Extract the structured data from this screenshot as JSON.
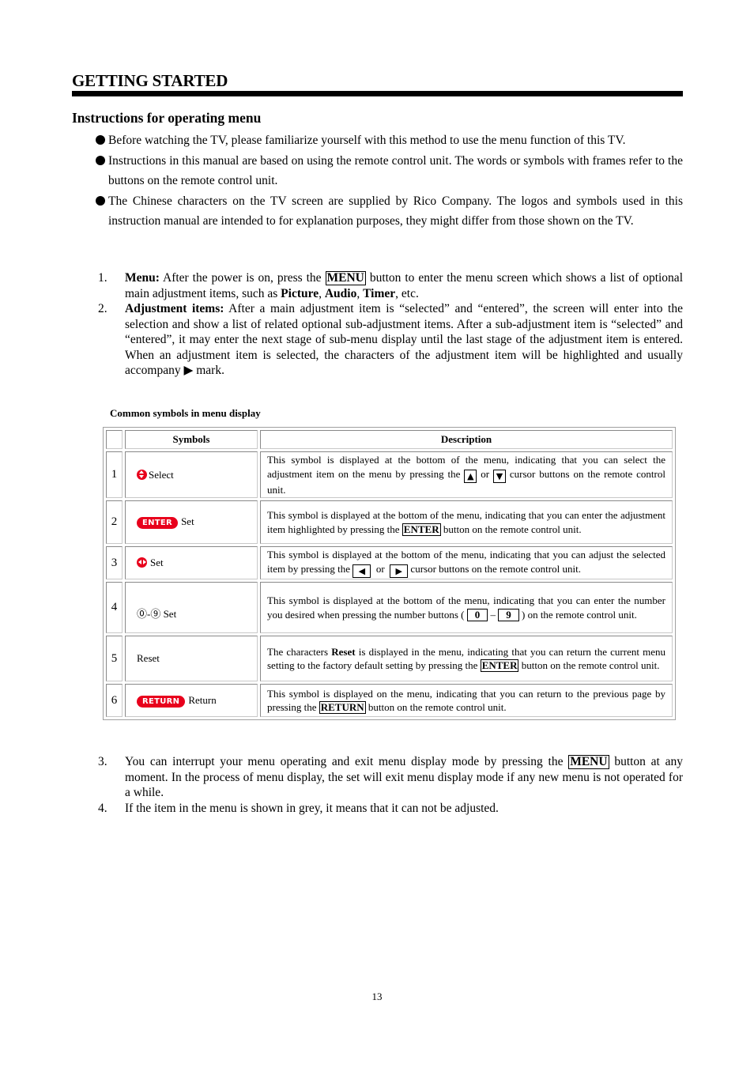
{
  "header": {
    "title": "GETTING STARTED",
    "section_heading": "Instructions for operating menu"
  },
  "bullets": [
    "Before watching the TV, please familiarize yourself with this method to use the menu function of this TV.",
    "Instructions in this manual are based on using the remote control unit. The words or symbols with frames refer to the buttons on the remote control unit.",
    "The Chinese characters on the TV screen are supplied by Rico Company. The logos and symbols used in this instruction manual are intended to for explanation purposes, they might differ from those shown on the TV."
  ],
  "steps_first": [
    {
      "num": "1.",
      "label": "Menu:",
      "text_a": " After the power is on, press the ",
      "key": "MENU",
      "text_b": " button to enter the menu screen which shows a list of optional main adjustment items, such as ",
      "b1": "Picture",
      "sep1": ", ",
      "b2": "Audio",
      "sep2": ", ",
      "b3": "Timer",
      "text_c": ", etc."
    },
    {
      "num": "2.",
      "label": "Adjustment items:",
      "text_a": " After a main adjustment item is “selected” and “entered”, the screen will enter into the selection and show a list of related optional sub-adjustment items. After a sub-adjustment item is “selected” and “entered”, it may enter the next stage of sub-menu display until the last stage of the adjustment item is entered. When an adjustment item is selected, the characters of the adjustment item will be highlighted and usually accompany ▶ mark."
    }
  ],
  "table": {
    "caption": "Common symbols in menu display",
    "headers": {
      "num": "",
      "symbols": "Symbols",
      "description": "Description"
    },
    "rows": [
      {
        "num": "1",
        "icon": "up-down-cursor-icon",
        "symbol_label": "Select",
        "d1": "This symbol is displayed at the bottom of the menu, indicating that you can select the adjustment item on the menu by pressing the ",
        "k1": "▲",
        "d2": " or ",
        "k2": "▼",
        "d3": " cursor buttons on the remote control unit."
      },
      {
        "num": "2",
        "icon": "enter-button-icon",
        "pill": "ENTER",
        "symbol_label": "Set",
        "d1": "This symbol is displayed at the bottom of the menu, indicating that you can enter the adjustment item highlighted by pressing the ",
        "k1": "ENTER",
        "d2": " button on the remote control unit."
      },
      {
        "num": "3",
        "icon": "left-right-cursor-icon",
        "symbol_label": "Set",
        "d1": "This symbol is displayed at the bottom of the menu, indicating that you can adjust the selected item by pressing the ",
        "k1": "◀",
        "d2": "  or  ",
        "k2": "▶",
        "d3": " cursor buttons on the remote control unit."
      },
      {
        "num": "4",
        "icon": "number-keys-icon",
        "symbol_label": "⓪-⑨ Set",
        "d1": "This symbol is displayed at the bottom of the menu, indicating that you can enter the number you desired when pressing the number buttons ( ",
        "k1": "0",
        "d2": " – ",
        "k2": "9",
        "d3": " ) on the remote control unit."
      },
      {
        "num": "5",
        "symbol_label": "Reset",
        "d1": "The characters ",
        "b1": "Reset",
        "d2": " is displayed in the menu, indicating that you can return the current menu setting to the factory default setting by pressing the ",
        "k1": "ENTER",
        "d3": " button on the remote control unit."
      },
      {
        "num": "6",
        "icon": "return-button-icon",
        "pill": "RETURN",
        "symbol_label": "Return",
        "d1": "This symbol is displayed on the menu, indicating that you can return to the previous page by pressing the ",
        "k1": "RETURN",
        "d2": " button on the remote control unit."
      }
    ]
  },
  "steps_second": [
    {
      "num": "3.",
      "text_a": "You can interrupt your menu operating and exit menu display mode by pressing the ",
      "key": "MENU",
      "text_b": " button at any moment. In the process of menu display, the set will exit menu display mode if any new menu is not operated for a while."
    },
    {
      "num": "4.",
      "text_a": "If the item in the menu is shown in grey, it means that it can not be adjusted."
    }
  ],
  "footer": {
    "page_number": "13"
  },
  "colors": {
    "icon_red": "#e8001c",
    "text": "#000000"
  }
}
